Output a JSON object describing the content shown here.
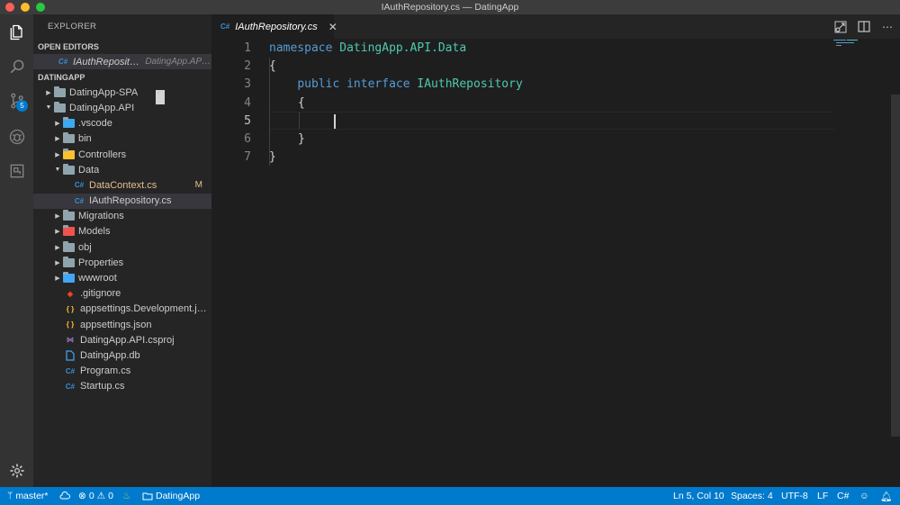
{
  "window": {
    "title": "IAuthRepository.cs — DatingApp"
  },
  "activity": {
    "scm_badge": "5"
  },
  "explorer": {
    "header": "EXPLORER",
    "open_editors": {
      "title": "OPEN EDITORS",
      "items": [
        {
          "icon": "C#",
          "name": "IAuthRepository.cs",
          "description": "DatingApp.API\\Data"
        }
      ]
    },
    "workspace": {
      "title": "DATINGAPP",
      "tree": [
        {
          "name": "DatingApp-SPA",
          "kind": "folder",
          "expanded": false
        },
        {
          "name": "DatingApp.API",
          "kind": "folder",
          "expanded": true
        },
        {
          "name": ".vscode",
          "kind": "folder",
          "expanded": false
        },
        {
          "name": "bin",
          "kind": "folder",
          "expanded": false
        },
        {
          "name": "Controllers",
          "kind": "folder",
          "expanded": false
        },
        {
          "name": "Data",
          "kind": "folder",
          "expanded": true
        },
        {
          "name": "DataContext.cs",
          "kind": "file",
          "icon": "C#",
          "status": "M"
        },
        {
          "name": "IAuthRepository.cs",
          "kind": "file",
          "icon": "C#",
          "selected": true
        },
        {
          "name": "Migrations",
          "kind": "folder",
          "expanded": false
        },
        {
          "name": "Models",
          "kind": "folder",
          "expanded": false
        },
        {
          "name": "obj",
          "kind": "folder",
          "expanded": false
        },
        {
          "name": "Properties",
          "kind": "folder",
          "expanded": false
        },
        {
          "name": "wwwroot",
          "kind": "folder",
          "expanded": false
        },
        {
          "name": ".gitignore",
          "kind": "file",
          "icon": "git"
        },
        {
          "name": "appsettings.Development.json",
          "kind": "file",
          "icon": "{ }"
        },
        {
          "name": "appsettings.json",
          "kind": "file",
          "icon": "{ }"
        },
        {
          "name": "DatingApp.API.csproj",
          "kind": "file",
          "icon": "vs"
        },
        {
          "name": "DatingApp.db",
          "kind": "file",
          "icon": "doc"
        },
        {
          "name": "Program.cs",
          "kind": "file",
          "icon": "C#"
        },
        {
          "name": "Startup.cs",
          "kind": "file",
          "icon": "C#"
        }
      ]
    }
  },
  "editor": {
    "tab": {
      "icon": "C#",
      "label": "IAuthRepository.cs",
      "close": "✕"
    },
    "line_numbers": [
      "1",
      "2",
      "3",
      "4",
      "5",
      "6",
      "7"
    ],
    "code": {
      "l1": {
        "kw": "namespace",
        "ns": "DatingApp.API.Data"
      },
      "l2": "{",
      "l3": {
        "kw1": "public",
        "kw2": "interface",
        "type": "IAuthRepository"
      },
      "l4": "{",
      "l5": "",
      "l6": "}",
      "l7": "}"
    },
    "cursor": {
      "line": 5,
      "column": 10
    }
  },
  "status": {
    "branch": "master*",
    "errors": "0",
    "warnings": "0",
    "project": "DatingApp",
    "position": "Ln 5, Col 10",
    "spaces": "Spaces: 4",
    "encoding": "UTF-8",
    "eol": "LF",
    "language": "C#"
  },
  "colors": {
    "accent": "#007acc",
    "keyword": "#569cd6",
    "type": "#4ec9b0",
    "modified": "#e2c08d"
  }
}
